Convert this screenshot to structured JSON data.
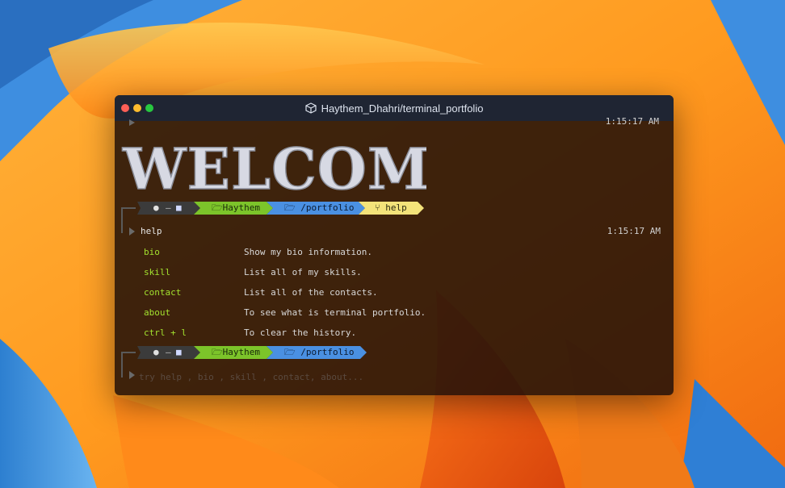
{
  "window": {
    "title": "Haythem_Dhahri/terminal_portfolio"
  },
  "terminal": {
    "prev_timestamp": "1:15:17 AM",
    "banner_text": "WELCOME",
    "prompt1": {
      "user_segment": "Haythem",
      "dir_segment": "/portfolio",
      "cmd_segment": "help"
    },
    "command": "help",
    "command_timestamp": "1:15:17 AM",
    "help_rows": [
      {
        "cmd": "bio",
        "desc": "Show my bio information."
      },
      {
        "cmd": "skill",
        "desc": "List all of my skills."
      },
      {
        "cmd": "contact",
        "desc": "List all of the contacts."
      },
      {
        "cmd": "about",
        "desc": "To see what is terminal portfolio."
      },
      {
        "cmd": "ctrl + l",
        "desc": "To clear the history."
      }
    ],
    "prompt2": {
      "user_segment": "Haythem",
      "dir_segment": "/portfolio"
    },
    "input_placeholder": "try help , bio , skill , contact, about..."
  },
  "colors": {
    "segment_dark": "#3b3b3b",
    "segment_green": "#7cc42a",
    "segment_blue": "#4a90e2",
    "segment_yellow": "#f3e37a",
    "command_green": "#a3e22f"
  },
  "icons": {
    "apple": "apple-icon",
    "folder": "folder-icon",
    "git_branch": "git-branch-icon",
    "box": "box-icon"
  }
}
